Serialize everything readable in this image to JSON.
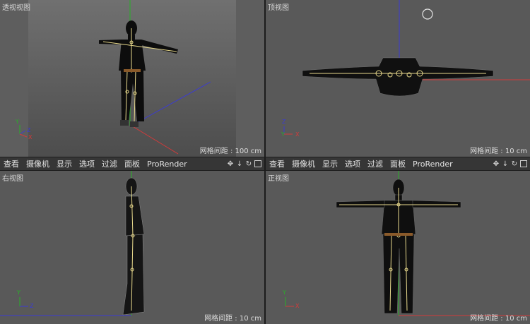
{
  "viewports": {
    "perspective": {
      "title": "透视视图",
      "grid": "网格间距 : 100 cm"
    },
    "top": {
      "title": "顶视图",
      "grid": "网格间距 : 10 cm"
    },
    "right": {
      "title": "右视图",
      "grid": "网格间距 : 10 cm"
    },
    "front": {
      "title": "正视图",
      "grid": "网格间距 : 10 cm"
    }
  },
  "menu": {
    "items": [
      "查看",
      "摄像机",
      "显示",
      "选项",
      "过滤",
      "面板",
      "ProRender"
    ]
  },
  "axis_labels": {
    "x": "X",
    "y": "Y",
    "z": "Z"
  },
  "icons": [
    "move-icon",
    "down-arrow-icon",
    "rotate-icon",
    "maximize-icon"
  ],
  "colors": {
    "viewport_bg": "#595959",
    "x_axis": "#d43a3a",
    "y_axis": "#27b127",
    "z_axis": "#3b3bd4",
    "bone": "#e8d98c"
  }
}
